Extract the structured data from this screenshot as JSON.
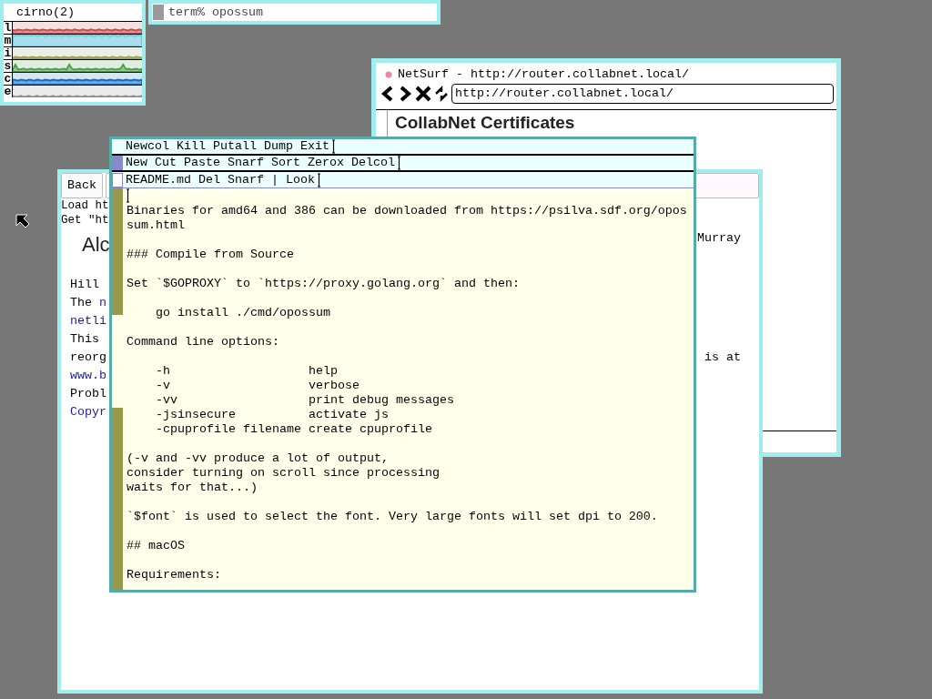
{
  "stats_window": {
    "title": "cirno(2)",
    "graphs": [
      {
        "label": "l",
        "color": "#c05050"
      },
      {
        "label": "m",
        "color": "#70c8e0"
      },
      {
        "label": "i",
        "color": "#a0a060"
      },
      {
        "label": "s",
        "color": "#50a050"
      },
      {
        "label": "c",
        "color": "#1070c0"
      },
      {
        "label": "e",
        "color": "#909090"
      }
    ]
  },
  "terminal_window": {
    "text": "term% opossum"
  },
  "netsurf_window": {
    "title": "NetSurf - http://router.collabnet.local/",
    "url": "http://router.collabnet.local/",
    "heading": "CollabNet Certificates"
  },
  "browser_window": {
    "back_button": "Back",
    "log_lines": [
      "Load ht",
      "Get \"ht"
    ],
    "heading": "Alc",
    "heading_right": "Murray",
    "lines": [
      {
        "parts": [
          {
            "text": "Hill",
            "link": false
          }
        ]
      },
      {
        "parts": [
          {
            "text": "The ",
            "link": false
          },
          {
            "text": "n",
            "link": true
          }
        ]
      },
      {
        "parts": [
          {
            "text": "netli",
            "link": true
          }
        ]
      },
      {
        "parts": [
          {
            "text": "This",
            "link": false
          }
        ]
      },
      {
        "parts": [
          {
            "text": "reorg",
            "link": false
          }
        ],
        "right": "is at"
      },
      {
        "parts": [
          {
            "text": "www.b",
            "link": true
          }
        ]
      },
      {
        "parts": [
          {
            "text": "Probl",
            "link": false
          }
        ]
      },
      {
        "parts": [
          {
            "text": "Copyr",
            "link": true
          }
        ]
      }
    ]
  },
  "acme_window": {
    "row_tag": "Newcol Kill Putall Dump Exit",
    "column_tag": "New Cut Paste Snarf Sort Zerox Delcol",
    "window_tag": "README.md Del Snarf | Look",
    "body": [
      "Binaries for amd64 and 386 can be downloaded from https://psilva.sdf.org/opos\nsum.html",
      "### Compile from Source",
      "Set `$GOPROXY` to `https://proxy.golang.org` and then:",
      "    go install ./cmd/opossum",
      "Command line options:",
      "    -h                   help\n    -v                   verbose\n    -vv                  print debug messages\n    -jsinsecure          activate js\n    -cpuprofile filename create cpuprofile",
      "(-v and -vv produce a lot of output,\nconsider turning on scroll since processing\nwaits for that...)",
      "`$font` is used to select the font. Very large fonts will set dpi to 200.",
      "## macOS",
      "Requirements:"
    ]
  }
}
